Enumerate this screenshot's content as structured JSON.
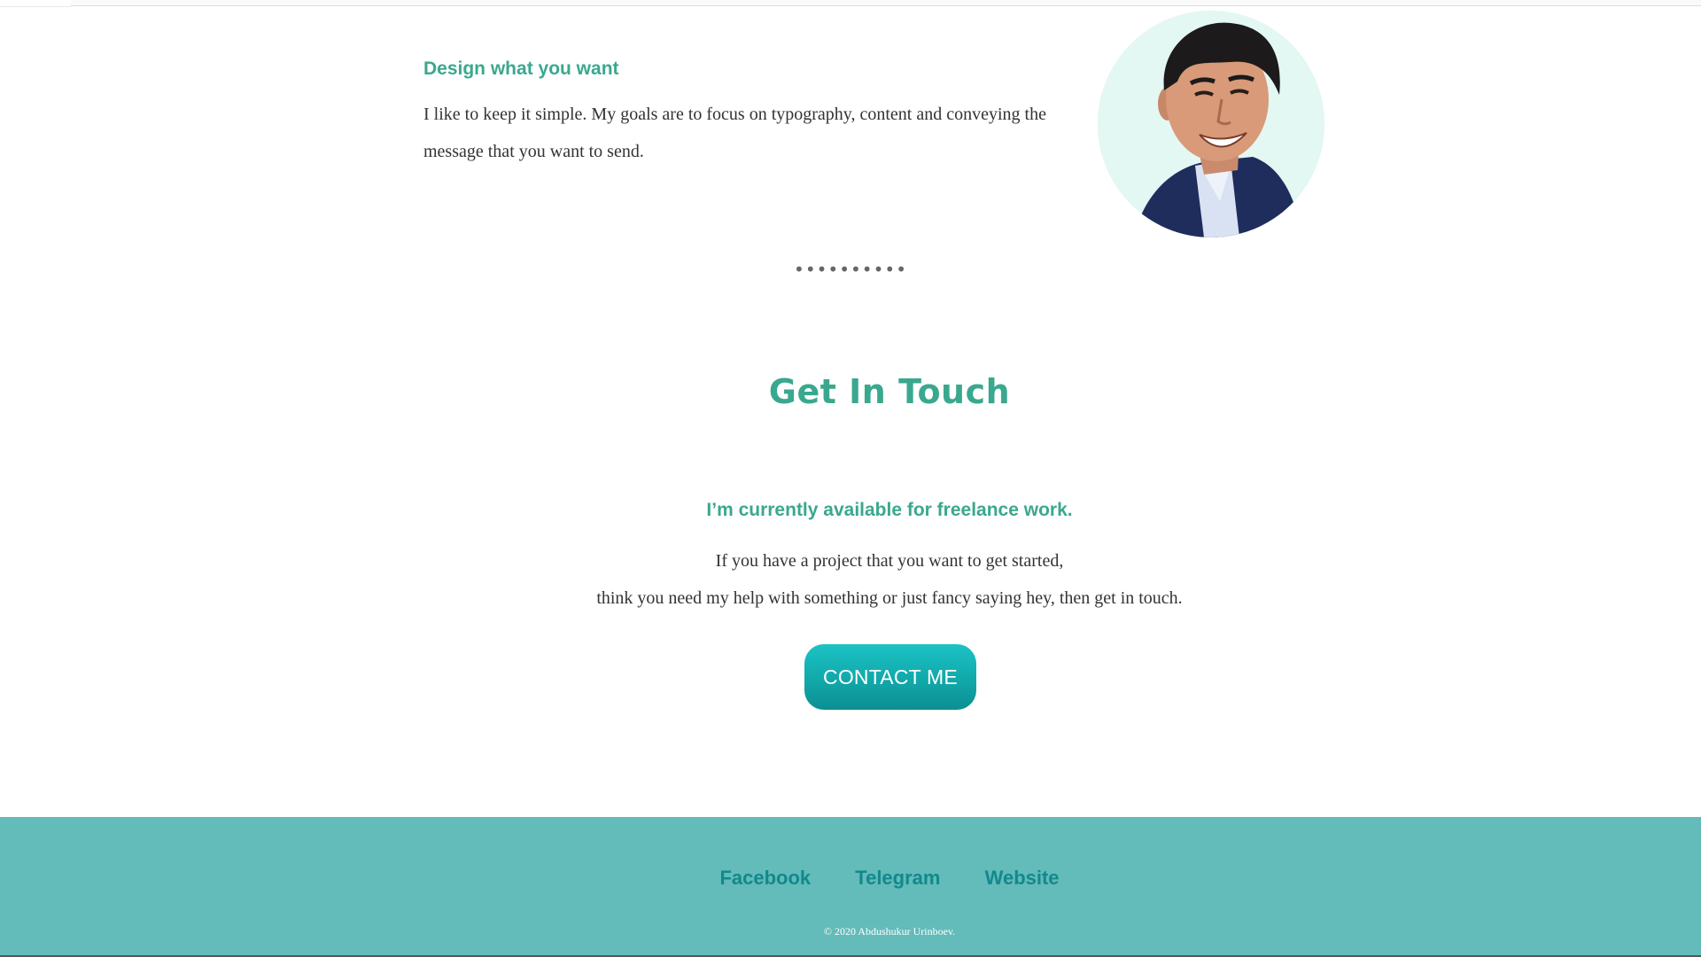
{
  "about": {
    "heading": "Design what you want",
    "text": "I like to keep it simple. My goals are to focus on typography, content and conveying the message that you want to send.",
    "avatar_icon": "portrait-photo"
  },
  "separator": "••••••••••",
  "contact": {
    "title": "Get In Touch",
    "available": "I’m currently available for freelance work.",
    "line1": "If you have a project that you want to get started,",
    "line2": "think you need my help with something or just fancy saying hey, then get in touch.",
    "button_label": "CONTACT ME"
  },
  "footer": {
    "links": [
      "Facebook",
      "Telegram",
      "Website"
    ],
    "copyright": "© 2020 Abdushukur Urinboev."
  },
  "colors": {
    "accent": "#3aa88e",
    "footer_bg": "#63bbba",
    "footer_link": "#12898b",
    "button": "#11a8aa"
  }
}
